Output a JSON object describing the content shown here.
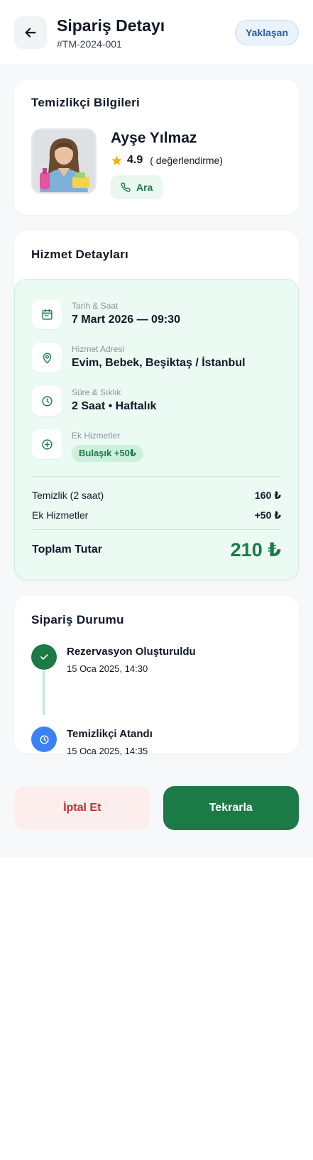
{
  "header": {
    "title": "Sipariş Detayı",
    "order_id": "#TM-2024-001",
    "status": "Yaklaşan",
    "back_icon": "arrow-left-icon"
  },
  "cleaner": {
    "section_title": "Temizlikçi Bilgileri",
    "name": "Ayşe Yılmaz",
    "rating": "4.9",
    "rating_text": "( değerlendirme)",
    "call_label": "Ara"
  },
  "service": {
    "section_title": "Hizmet Detayları",
    "date": {
      "label": "Tarih & Saat",
      "value": "7 Mart 2026 — 09:30",
      "icon": "calendar-icon"
    },
    "address": {
      "label": "Hizmet Adresi",
      "value": "Evim, Bebek, Beşiktaş / İstanbul",
      "icon": "location-pin-icon"
    },
    "duration": {
      "label": "Süre & Sıklık",
      "value": "2 Saat • Haftalık",
      "icon": "clock-icon"
    },
    "extras": {
      "label": "Ek Hizmetler",
      "chip": "Bulaşık +50₺",
      "icon": "plus-circle-icon"
    },
    "price_lines": [
      {
        "label": "Temizlik (2 saat)",
        "amount": "160 ₺"
      },
      {
        "label": "Ek Hizmetler",
        "amount": "+50 ₺"
      }
    ],
    "total_label": "Toplam Tutar",
    "total_value": "210 ₺"
  },
  "status": {
    "section_title": "Sipariş Durumu",
    "steps": [
      {
        "title": "Rezervasyon Oluşturuldu",
        "time": "15 Oca 2025, 14:30",
        "icon": "check-icon",
        "color": "#1c7a47"
      },
      {
        "title": "Temizlikçi Atandı",
        "time": "15 Oca 2025, 14:35",
        "icon": "clock-icon",
        "color": "#3b82f6"
      }
    ]
  },
  "actions": {
    "cancel_label": "İptal Et",
    "repeat_label": "Tekrarla"
  },
  "colors": {
    "primary_green": "#1c7a47",
    "danger_red": "#c53030",
    "info_blue": "#3b82f6"
  }
}
